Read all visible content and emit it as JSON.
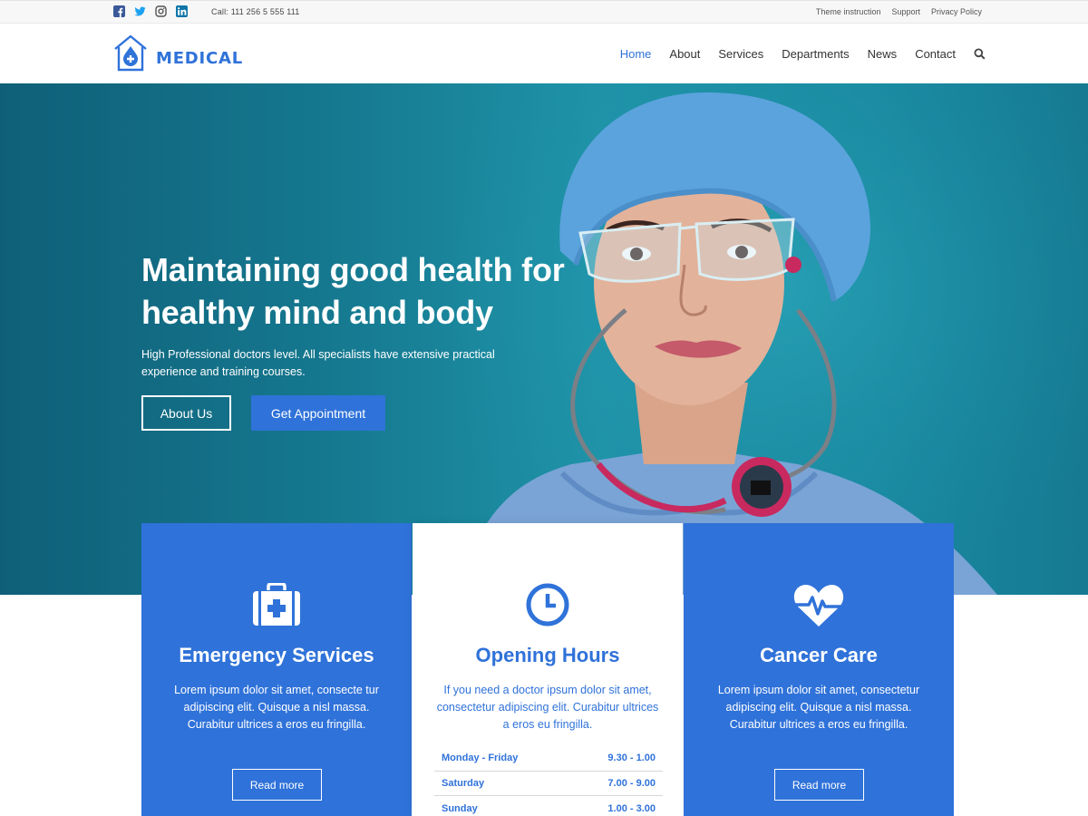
{
  "topbar": {
    "socials": [
      "facebook-icon",
      "twitter-icon",
      "instagram-icon",
      "linkedin-icon"
    ],
    "call": "Call: 111 256 5 555 111",
    "links": [
      "Theme instruction",
      "Support",
      "Privacy Policy"
    ]
  },
  "header": {
    "logo_text": "MEDICAL",
    "nav": [
      "Home",
      "About",
      "Services",
      "Departments",
      "News",
      "Contact"
    ],
    "active": "Home"
  },
  "hero": {
    "title": "Maintaining good health for healthy mind and body",
    "subtitle": "High Professional doctors level. All specialists have extensive practical experience and training courses.",
    "btn_about": "About Us",
    "btn_appointment": "Get Appointment"
  },
  "cards": {
    "emergency": {
      "icon": "first-aid-kit-icon",
      "title": "Emergency Services",
      "text": "Lorem ipsum dolor sit amet, consecte tur adipiscing elit. Quisque a nisl massa. Curabitur ultrices a eros eu fringilla.",
      "button": "Read more"
    },
    "hours": {
      "icon": "clock-icon",
      "title": "Opening Hours",
      "text": "If you need a doctor ipsum dolor sit amet, consectetur adipiscing elit. Curabitur ultrices a eros eu fringilla.",
      "rows": [
        {
          "day": "Monday - Friday",
          "time": "9.30 - 1.00"
        },
        {
          "day": "Saturday",
          "time": "7.00 - 9.00"
        },
        {
          "day": "Sunday",
          "time": "1.00 - 3.00"
        }
      ]
    },
    "cancer": {
      "icon": "heartbeat-icon",
      "title": "Cancer Care",
      "text": "Lorem ipsum dolor sit amet, consectetur adipiscing elit. Quisque a nisl massa. Curabitur ultrices a eros eu fringilla.",
      "button": "Read more"
    }
  },
  "colors": {
    "accent": "#2f72d9",
    "hero_teal": "#1a8aa1",
    "topbar_bg": "#f7f7f7"
  }
}
